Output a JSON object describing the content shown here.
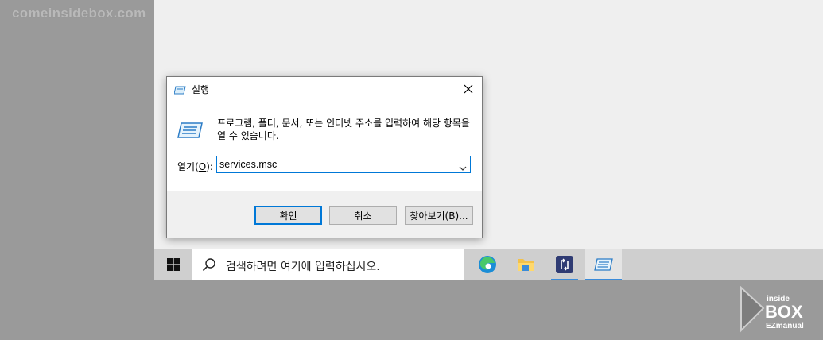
{
  "watermark": "comeinsidebox.com",
  "dialog": {
    "title": "실행",
    "description": "프로그램, 폴더, 문서, 또는 인터넷 주소를 입력하여 해당 항목을 열 수 있습니다.",
    "open_label_prefix": "열기(",
    "open_label_key": "O",
    "open_label_suffix": "):",
    "open_value": "services.msc",
    "buttons": {
      "ok": "확인",
      "cancel": "취소",
      "browse": "찾아보기(B)..."
    }
  },
  "taskbar": {
    "search_placeholder": "검색하려면 여기에 입력하십시오.",
    "icons": [
      "edge-icon",
      "file-explorer-icon",
      "remote-desktop-icon",
      "run-icon"
    ]
  },
  "logo": {
    "line1": "inside",
    "line2": "BOX",
    "line3": "EZmanual"
  },
  "colors": {
    "accent": "#0078d7",
    "desktop": "#efefef",
    "taskbar": "#cfcfcf",
    "background": "#9a9a9a"
  }
}
